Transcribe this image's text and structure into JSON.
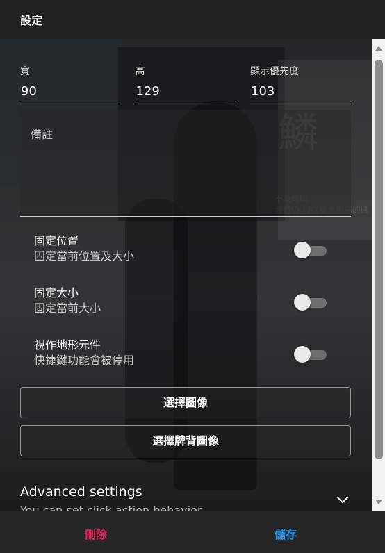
{
  "dialog": {
    "title": "設定"
  },
  "fields": {
    "width": {
      "label": "寬",
      "value": "90"
    },
    "height": {
      "label": "高",
      "value": "129"
    },
    "priority": {
      "label": "顯示優先度",
      "value": "103"
    }
  },
  "notes": {
    "placeholder": "備註"
  },
  "toggles": [
    {
      "title": "固定位置",
      "subtitle": "固定當前位置及大小",
      "on": false
    },
    {
      "title": "固定大小",
      "subtitle": "固定當前大小",
      "on": false
    },
    {
      "title": "視作地形元件",
      "subtitle": "快捷鍵功能會被停用",
      "on": false
    }
  ],
  "buttons": {
    "select_image": "選擇圖像",
    "select_back_image": "選擇牌背圖像"
  },
  "advanced": {
    "title": "Advanced settings",
    "subtitle": "You can set click action behavior"
  },
  "footer": {
    "delete_label": "刪除",
    "save_label": "儲存"
  },
  "background_art": {
    "glyph": "鱗",
    "caption_lines": [
      "不及時間,",
      "我們仍 可以嘆息和痛的碰"
    ]
  },
  "colors": {
    "delete": "#e0245e",
    "save": "#2196f3",
    "titlebar": "#212121"
  }
}
